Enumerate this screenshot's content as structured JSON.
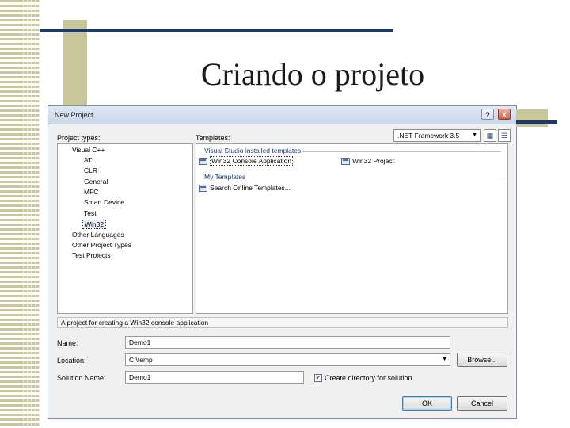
{
  "slide": {
    "title": "Criando o projeto"
  },
  "dialog": {
    "title": "New Project",
    "help_glyph": "?",
    "close_glyph": "X",
    "project_types_label": "Project types:",
    "templates_label": "Templates:",
    "framework_value": ".NET Framework 3.5",
    "project_types": [
      {
        "label": "Visual C++",
        "level": 0,
        "selected": false
      },
      {
        "label": "ATL",
        "level": 1,
        "selected": false
      },
      {
        "label": "CLR",
        "level": 1,
        "selected": false
      },
      {
        "label": "General",
        "level": 1,
        "selected": false
      },
      {
        "label": "MFC",
        "level": 1,
        "selected": false
      },
      {
        "label": "Smart Device",
        "level": 1,
        "selected": false
      },
      {
        "label": "Test",
        "level": 1,
        "selected": false
      },
      {
        "label": "Win32",
        "level": 1,
        "selected": true
      },
      {
        "label": "Other Languages",
        "level": 0,
        "selected": false
      },
      {
        "label": "Other Project Types",
        "level": 0,
        "selected": false
      },
      {
        "label": "Test Projects",
        "level": 0,
        "selected": false
      }
    ],
    "template_groups": {
      "installed": "Visual Studio installed templates",
      "my": "My Templates"
    },
    "templates": {
      "console_app": "Win32 Console Application",
      "win32_project": "Win32 Project",
      "search_online": "Search Online Templates..."
    },
    "description": "A project for creating a Win32 console application",
    "name_label": "Name:",
    "name_value": "Demo1",
    "location_label": "Location:",
    "location_value": "C:\\temp",
    "solution_label": "Solution Name:",
    "solution_value": "Demo1",
    "browse_label": "Browse...",
    "create_dir_label": "Create directory for solution",
    "create_dir_checked": true,
    "ok_label": "OK",
    "cancel_label": "Cancel"
  },
  "colors": {
    "accent_navy": "#1f3864",
    "accent_olive": "#c9c79a"
  }
}
